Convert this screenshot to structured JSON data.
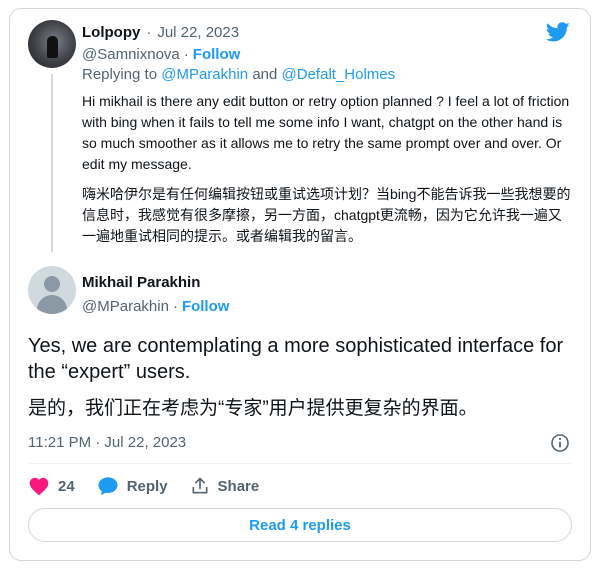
{
  "colors": {
    "accent": "#1d9bf0",
    "like": "#f91880",
    "muted": "#536471",
    "text": "#0f1419",
    "border": "#cfd9de"
  },
  "icons": [
    "twitter-logo",
    "info-icon",
    "heart-icon",
    "reply-icon",
    "share-icon"
  ],
  "reply_tweet": {
    "author_name": "Lolpopy",
    "separator": "·",
    "date": "Jul 22, 2023",
    "handle": "@Samnixnova",
    "follow_label": "Follow",
    "replying_prefix": "Replying to",
    "replying_to_1": "@MParakhin",
    "replying_and": "and",
    "replying_to_2": "@Defalt_Holmes",
    "text_en": "Hi mikhail is there any edit button or retry option planned ? I feel a lot of friction with bing when it fails to tell me some info I want, chatgpt on the other hand is so much smoother as it allows me to retry the same prompt over and over. Or edit my message.",
    "text_zh": "嗨米哈伊尔是有任何编辑按钮或重试选项计划？当bing不能告诉我一些我想要的信息时，我感觉有很多摩擦，另一方面，chatgpt更流畅，因为它允许我一遍又一遍地重试相同的提示。或者编辑我的留言。"
  },
  "main_tweet": {
    "author_name": "Mikhail Parakhin",
    "handle": "@MParakhin",
    "separator": "·",
    "follow_label": "Follow",
    "text_en": "Yes, we are contemplating a more sophisticated interface for the “expert” users.",
    "text_zh": "是的，我们正在考虑为“专家”用户提供更复杂的界面。",
    "timestamp": "11:21 PM · Jul 22, 2023"
  },
  "actions": {
    "like_count": "24",
    "reply_label": "Reply",
    "share_label": "Share"
  },
  "read_replies_label": "Read 4 replies"
}
